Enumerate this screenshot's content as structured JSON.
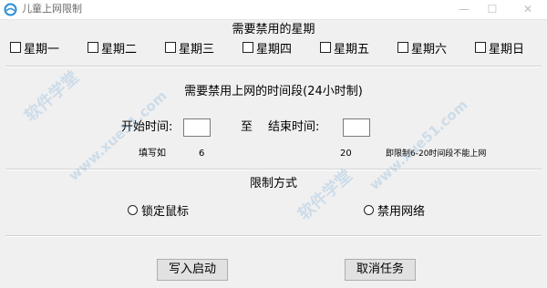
{
  "window": {
    "title": "儿童上网限制"
  },
  "weekdays_section": {
    "title": "需要禁用的星期",
    "days": [
      {
        "label": "星期一",
        "checked": false
      },
      {
        "label": "星期二",
        "checked": false
      },
      {
        "label": "星期三",
        "checked": false
      },
      {
        "label": "星期四",
        "checked": false
      },
      {
        "label": "星期五",
        "checked": false
      },
      {
        "label": "星期六",
        "checked": false
      },
      {
        "label": "星期日",
        "checked": false
      }
    ]
  },
  "time_section": {
    "title": "需要禁用上网的时间段(24小时制)",
    "start_label": "开始时间:",
    "to_label": "至",
    "end_label": "结束时间:",
    "start_value": "",
    "end_value": "",
    "example": {
      "prefix": "填写如",
      "start": "6",
      "end": "20",
      "note": "即限制6-20时间段不能上网"
    }
  },
  "method_section": {
    "title": "限制方式",
    "options": [
      {
        "label": "锁定鼠标",
        "selected": false
      },
      {
        "label": "禁用网络",
        "selected": false
      }
    ]
  },
  "buttons": {
    "write_start": "写入启动",
    "cancel_task": "取消任务"
  },
  "watermark": {
    "text1": "软件学堂",
    "text2": "www.xue51.com"
  },
  "colors": {
    "window_bg": "#f0f0f0",
    "icon_blue": "#2b8fd6",
    "watermark_blue": "#5096d2"
  }
}
